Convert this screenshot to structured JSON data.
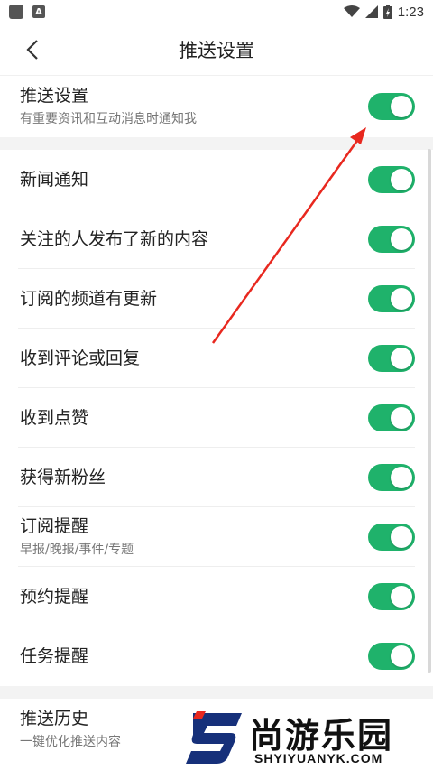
{
  "status_bar": {
    "time": "1:23",
    "icons": [
      "app-square-icon",
      "app-a-icon",
      "wifi-icon",
      "signal-icon",
      "battery-icon"
    ]
  },
  "nav": {
    "title": "推送设置",
    "back_icon": "chevron-left-icon"
  },
  "push_master": {
    "title": "推送设置",
    "subtitle": "有重要资讯和互动消息时通知我",
    "enabled": true
  },
  "settings": [
    {
      "title": "新闻通知",
      "subtitle": "",
      "enabled": true
    },
    {
      "title": "关注的人发布了新的内容",
      "subtitle": "",
      "enabled": true
    },
    {
      "title": "订阅的频道有更新",
      "subtitle": "",
      "enabled": true
    },
    {
      "title": "收到评论或回复",
      "subtitle": "",
      "enabled": true
    },
    {
      "title": "收到点赞",
      "subtitle": "",
      "enabled": true
    },
    {
      "title": "获得新粉丝",
      "subtitle": "",
      "enabled": true
    },
    {
      "title": "订阅提醒",
      "subtitle": "早报/晚报/事件/专题",
      "enabled": true
    },
    {
      "title": "预约提醒",
      "subtitle": "",
      "enabled": true
    },
    {
      "title": "任务提醒",
      "subtitle": "",
      "enabled": true
    }
  ],
  "history": {
    "title": "推送历史",
    "subtitle": "一键优化推送内容"
  },
  "watermark": {
    "brand": "尚游乐园",
    "url": "SHYIYUANYK.COM"
  },
  "colors": {
    "toggle_on": "#1fb26b",
    "annotation_arrow": "#e8281f",
    "section_gap": "#f3f3f3"
  }
}
